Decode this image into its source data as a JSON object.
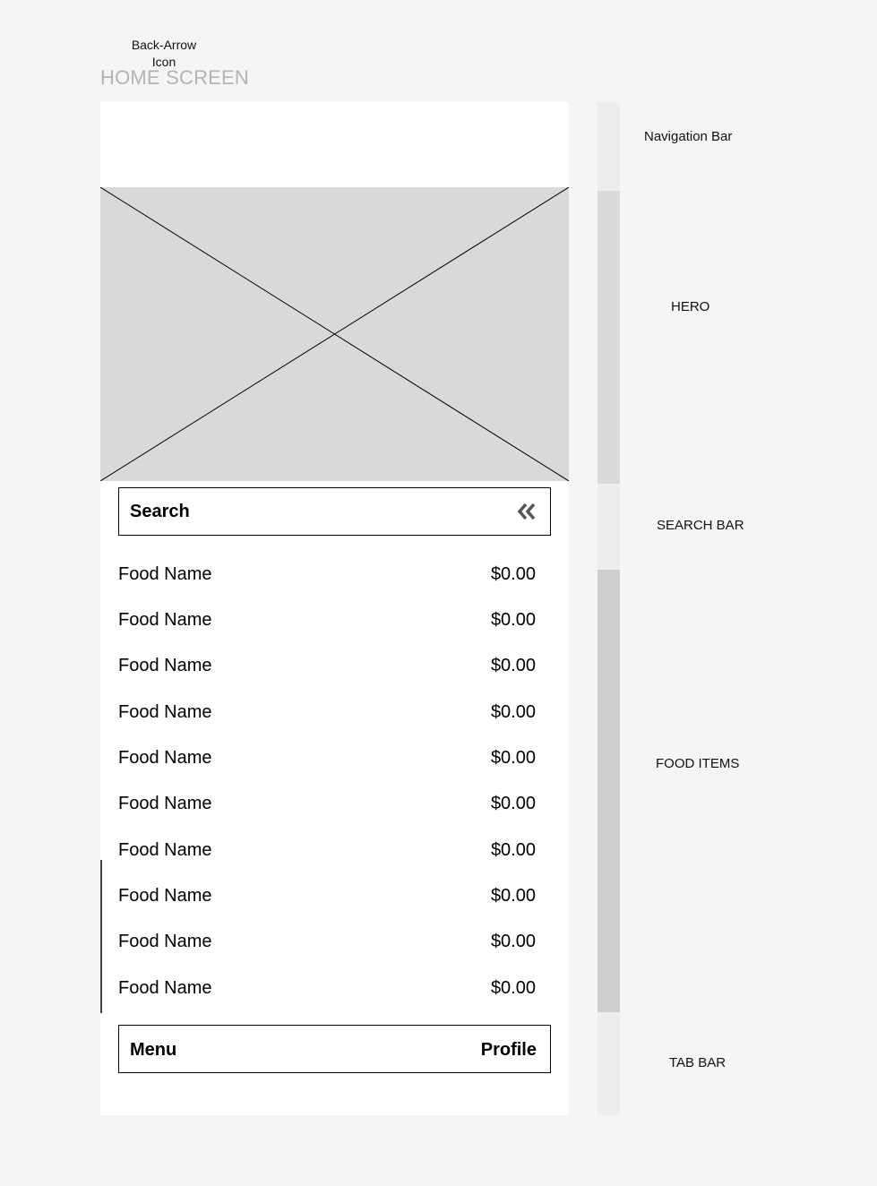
{
  "annotations": {
    "back_arrow_line1": "Back-Arrow",
    "back_arrow_line2": "Icon"
  },
  "screen": {
    "title": "HOME SCREEN"
  },
  "search": {
    "label": "Search",
    "icon": "double-chevron-left-icon"
  },
  "food_items": [
    {
      "name": "Food Name",
      "price": "$0.00"
    },
    {
      "name": "Food Name",
      "price": "$0.00"
    },
    {
      "name": "Food Name",
      "price": "$0.00"
    },
    {
      "name": "Food Name",
      "price": "$0.00"
    },
    {
      "name": "Food Name",
      "price": "$0.00"
    },
    {
      "name": "Food Name",
      "price": "$0.00"
    },
    {
      "name": "Food Name",
      "price": "$0.00"
    },
    {
      "name": "Food Name",
      "price": "$0.00"
    },
    {
      "name": "Food Name",
      "price": "$0.00"
    },
    {
      "name": "Food Name",
      "price": "$0.00"
    }
  ],
  "tab_bar": {
    "menu": "Menu",
    "profile": "Profile"
  },
  "section_labels": {
    "navigation_bar": "Navigation Bar",
    "hero": "HERO",
    "search_bar": "SEARCH BAR",
    "food_items": "FOOD ITEMS",
    "tab_bar": "TAB BAR"
  },
  "colors": {
    "background": "#f5f5f5",
    "screen": "#ffffff",
    "placeholder": "#d9d9d9",
    "strip_light": "#ededed",
    "strip_mid": "#dadada",
    "strip_dark": "#cfcfcf",
    "title_gray": "#b3b3b3"
  }
}
